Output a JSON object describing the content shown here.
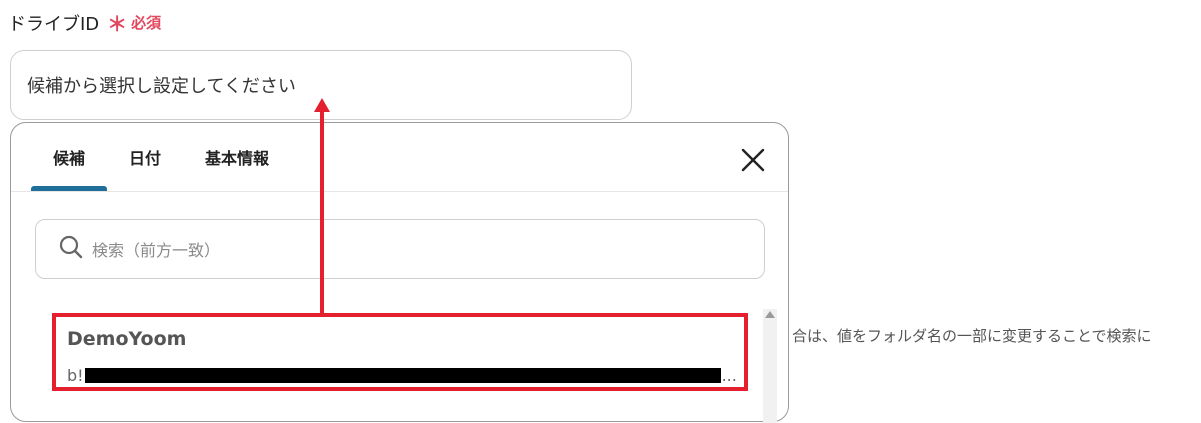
{
  "field": {
    "label": "ドライブID",
    "required_asterisk": "＊",
    "required_text": "必須",
    "input_value": "候補から選択し設定してください"
  },
  "dropdown": {
    "tabs": [
      {
        "label": "候補",
        "active": true
      },
      {
        "label": "日付",
        "active": false
      },
      {
        "label": "基本情報",
        "active": false
      }
    ],
    "close_icon": "close-icon",
    "search": {
      "icon": "search-icon",
      "placeholder": "検索（前方一致）"
    },
    "results": [
      {
        "title": "DemoYoom",
        "sub_prefix": "b!",
        "sub_suffix": "..."
      }
    ]
  },
  "side_note": "合は、値をフォルダ名の一部に変更することで検索に",
  "colors": {
    "accent": "#1f6f9a",
    "required": "#e2475e",
    "annotation_red": "#e5202e"
  }
}
